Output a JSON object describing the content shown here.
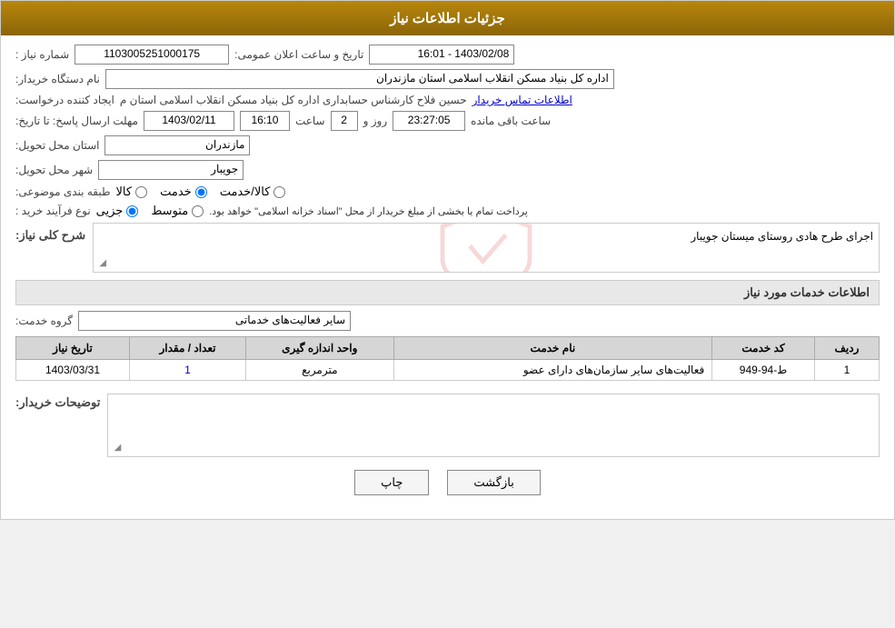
{
  "header": {
    "title": "جزئیات اطلاعات نیاز"
  },
  "fields": {
    "shmare_niaz_label": "شماره نیاز :",
    "shmare_niaz_value": "1103005251000175",
    "tarikh_label": "تاریخ و ساعت اعلان عمومی:",
    "tarikh_value": "1403/02/08 - 16:01",
    "nam_dastgah_label": "نام دستگاه خریدار:",
    "nam_dastgah_value": "اداره کل بنیاد مسکن انقلاب اسلامی استان مازندران",
    "ijad_label": "ایجاد کننده درخواست:",
    "ijad_value": "حسین فلاح کارشناس حسابداری اداره کل بنیاد مسکن انقلاب اسلامی استان م",
    "ijad_link": "اطلاعات تماس خریدار",
    "mohlat_label": "مهلت ارسال پاسخ: تا تاریخ:",
    "mohlat_date": "1403/02/11",
    "mohlat_saat_label": "ساعت",
    "mohlat_saat": "16:10",
    "mohlat_roz_label": "روز و",
    "mohlat_roz": "2",
    "mohlat_remaining": "23:27:05",
    "mohlat_remaining_label": "ساعت باقی مانده",
    "ostan_label": "استان محل تحویل:",
    "ostan_value": "مازندران",
    "shahr_label": "شهر محل تحویل:",
    "shahr_value": "جویبار",
    "tabaqe_label": "طبقه بندی موضوعی:",
    "tabaqe_options": [
      "کالا",
      "خدمت",
      "کالا/خدمت"
    ],
    "tabaqe_selected": "خدمت",
    "nooe_farayand_label": "نوع فرآیند خرید :",
    "nooe_farayand_options": [
      "جزیی",
      "متوسط"
    ],
    "nooe_farayand_desc": "پرداخت تمام یا بخشی از مبلغ خریدار از محل \"اسناد خزانه اسلامی\" خواهد بود.",
    "sharh_label": "شرح کلی نیاز:",
    "sharh_value": "اجرای طرح هادی روستای میستان جویبار",
    "service_section_label": "اطلاعات خدمات مورد نیاز",
    "gorohe_khedmat_label": "گروه خدمت:",
    "gorohe_khedmat_value": "سایر فعالیت‌های خدماتی",
    "table": {
      "headers": [
        "ردیف",
        "کد خدمت",
        "نام خدمت",
        "واحد اندازه گیری",
        "تعداد / مقدار",
        "تاریخ نیاز"
      ],
      "rows": [
        {
          "radif": "1",
          "kod": "ط-94-949",
          "name": "فعالیت‌های سایر سازمان‌های دارای عضو",
          "vahed": "مترمربع",
          "tedad": "1",
          "tarikh": "1403/03/31"
        }
      ]
    },
    "toseeh_label": "توضیحات خریدار:",
    "toseeh_value": ""
  },
  "buttons": {
    "print_label": "چاپ",
    "back_label": "بازگشت"
  }
}
